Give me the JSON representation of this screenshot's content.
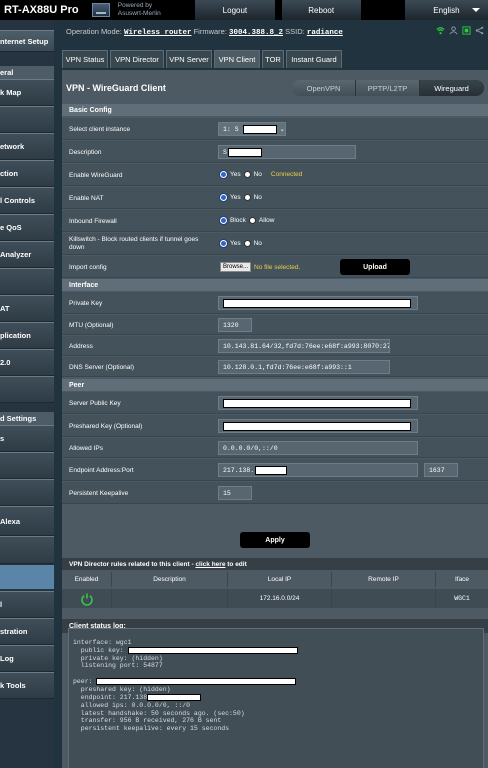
{
  "header": {
    "model": "RT-AX88U Pro",
    "powered_by": "Powered by",
    "firmware_brand": "Asuswrt-Merlin",
    "logout": "Logout",
    "reboot": "Reboot",
    "language": "English"
  },
  "sidebar": {
    "items": [
      "nternet Setup",
      "eral",
      "k Map",
      "etwork",
      "ction",
      "l Controls",
      "e QoS",
      "Analyzer",
      "AT",
      "plication",
      "2.0",
      "d Settings",
      "s",
      "Alexa",
      "l",
      "stration",
      "Log",
      "k Tools"
    ]
  },
  "opmode": {
    "label": "Operation Mode:",
    "mode": "Wireless router",
    "fw_label": "Firmware:",
    "firmware": "3004.388.8_2",
    "ssid_label": "SSID:",
    "ssid": "radiance"
  },
  "tabs": [
    "VPN Status",
    "VPN Director",
    "VPN Server",
    "VPN Client",
    "TOR",
    "Instant Guard"
  ],
  "panel": {
    "title": "VPN - WireGuard Client",
    "protocols": [
      "OpenVPN",
      "PPTP/L2TP",
      "Wireguard"
    ]
  },
  "basic": {
    "section": "Basic Config",
    "select_label": "Select client instance",
    "select_value": "1: S",
    "description_label": "Description",
    "description_value": "S",
    "enable_wg_label": "Enable WireGuard",
    "enable_nat_label": "Enable NAT",
    "firewall_label": "Inbound Firewall",
    "killswitch_label": "Killswitch - Block routed clients if tunnel goes down",
    "import_label": "Import config",
    "yes": "Yes",
    "no": "No",
    "block": "Block",
    "allow": "Allow",
    "connected": "Connected",
    "browse": "Browse...",
    "no_file": "No file selected.",
    "upload": "Upload"
  },
  "interface": {
    "section": "Interface",
    "private_key_label": "Private Key",
    "mtu_label": "MTU (Optional)",
    "mtu_value": "1320",
    "address_label": "Address",
    "address_value": "10.143.81.64/32,fd7d:76ee:e68f:a993:8070:2757:57",
    "dns_label": "DNS Server (Optional)",
    "dns_value": "10.128.0.1,fd7d:76ee:e68f:a993::1"
  },
  "peer": {
    "section": "Peer",
    "server_key_label": "Server Public Key",
    "psk_label": "Preshared Key (Optional)",
    "allowed_label": "Allowed IPs",
    "allowed_value": "0.0.0.0/0,::/0",
    "endpoint_label": "Endpoint Address:Port",
    "endpoint_value": "217.138.",
    "endpoint_port": "1637",
    "keepalive_label": "Persistent Keepalive",
    "keepalive_value": "15"
  },
  "apply": "Apply",
  "rules": {
    "title_prefix": "VPN Director rules related to this client - ",
    "title_link": "click here",
    "title_suffix": " to edit",
    "headers": [
      "Enabled",
      "Description",
      "Local IP",
      "Remote IP",
      "Iface"
    ],
    "row": {
      "local_ip": "172.16.0.0/24",
      "iface": "WGC1"
    }
  },
  "log": {
    "title": "Client status log:",
    "lines": [
      "interface: wgc1",
      "  public key:",
      "  private key: (hidden)",
      "  listening port: 54877",
      "",
      "peer:",
      "  preshared key: (hidden)",
      "  endpoint: 217.138",
      "  allowed ips: 0.0.0.0/0, ::/0",
      "  latest handshake: 50 seconds ago. (sec:50)",
      "  transfer: 956 B received, 276 B sent",
      "  persistent keepalive: every 15 seconds"
    ]
  },
  "colors": {
    "accent_yellow": "#e8d24a",
    "apply_bg": "#000000",
    "wifi_green": "#2ecc40"
  }
}
